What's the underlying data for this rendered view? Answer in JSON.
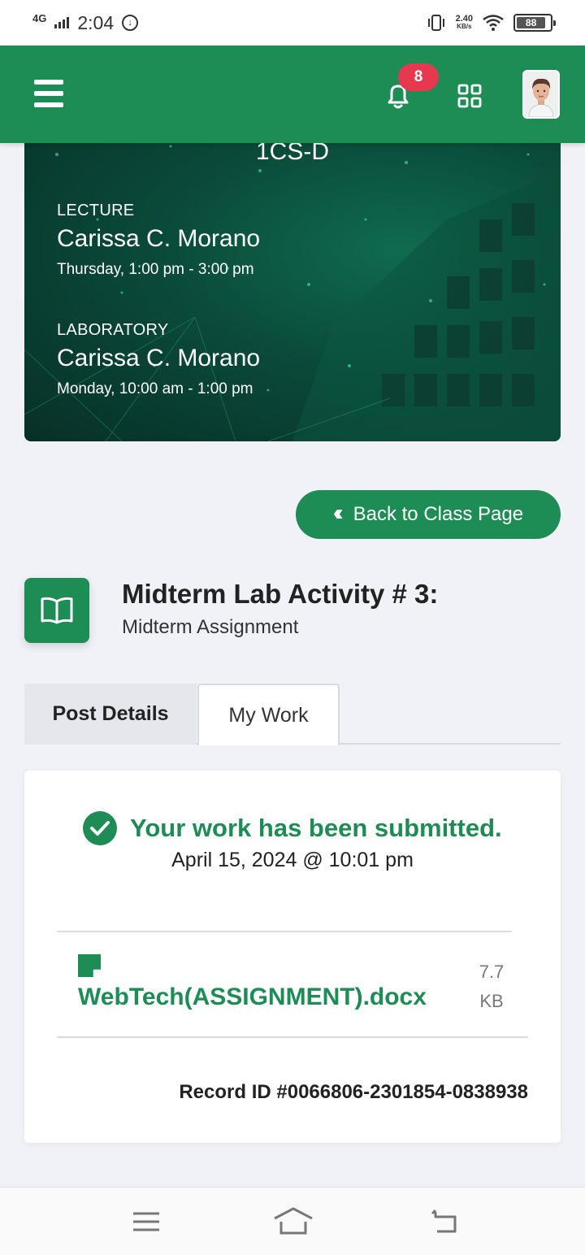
{
  "status_bar": {
    "network": "4G",
    "time": "2:04",
    "speed_value": "2.40",
    "speed_unit": "KB/s",
    "battery": "88"
  },
  "header": {
    "notification_count": "8"
  },
  "banner": {
    "class_code": "1CS-D",
    "lecture": {
      "type": "LECTURE",
      "instructor": "Carissa C. Morano",
      "schedule": "Thursday, 1:00 pm - 3:00 pm"
    },
    "laboratory": {
      "type": "LABORATORY",
      "instructor": "Carissa C. Morano",
      "schedule": "Monday, 10:00 am - 1:00 pm"
    }
  },
  "back_button": {
    "label": "Back to Class Page"
  },
  "activity": {
    "title": "Midterm Lab Activity # 3:",
    "subtitle": "Midterm Assignment"
  },
  "tabs": [
    {
      "label": "Post Details",
      "active": false
    },
    {
      "label": "My Work",
      "active": true
    }
  ],
  "submission": {
    "status": "Your work has been submitted.",
    "date": "April 15, 2024 @ 10:01 pm",
    "file_name": "WebTech(ASSIGNMENT).docx",
    "file_size_value": "7.7",
    "file_size_unit": "KB",
    "record_id": "Record ID #0066806-2301854-0838938"
  },
  "colors": {
    "brand_green": "#1e8c55",
    "badge_red": "#e63950"
  }
}
